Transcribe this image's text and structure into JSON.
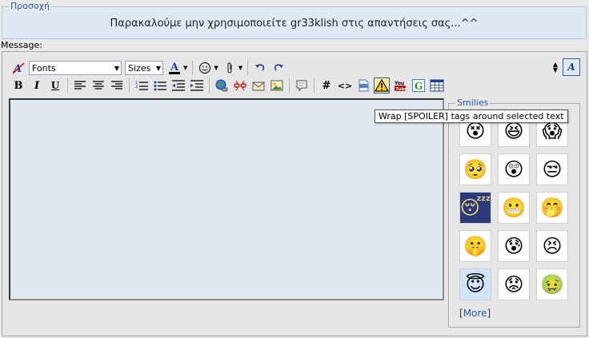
{
  "notice": {
    "legend": "Προσοχή",
    "text": "Παρακαλούμε μην χρησιμοποιείτε gr33klish στις απαντήσεις σας...^^"
  },
  "message_label": "Message:",
  "toolbar": {
    "fonts_value": "Fonts",
    "sizes_value": "Sizes",
    "bold": "B",
    "italic": "I",
    "underline": "U",
    "code_hash": "#",
    "code_tag": "<>",
    "wysiwyg_label": "A"
  },
  "tooltip": "Wrap [SPOILER] tags around selected text",
  "smilies": {
    "legend": "Smilies",
    "more_label": "More",
    "items": [
      {
        "glyph": "😵",
        "style": "light"
      },
      {
        "glyph": "😆",
        "style": "light"
      },
      {
        "glyph": "😱",
        "style": "light"
      },
      {
        "glyph": "🥺",
        "style": "light"
      },
      {
        "glyph": "😲",
        "style": "light"
      },
      {
        "glyph": "😒",
        "style": "light"
      },
      {
        "glyph": "😴",
        "style": "dark"
      },
      {
        "glyph": "😬",
        "style": "light"
      },
      {
        "glyph": "🤭",
        "style": "light"
      },
      {
        "glyph": "🤫",
        "style": "light"
      },
      {
        "glyph": "😰",
        "style": "light"
      },
      {
        "glyph": "😣",
        "style": "light"
      },
      {
        "glyph": "😇",
        "style": "blue"
      },
      {
        "glyph": "😟",
        "style": "light"
      },
      {
        "glyph": "🤢",
        "style": "light"
      }
    ]
  },
  "colors": {
    "accent": "#2a57a8",
    "textarea_bg": "#dfe9ef",
    "notice_bg": "#dfe9f3"
  }
}
